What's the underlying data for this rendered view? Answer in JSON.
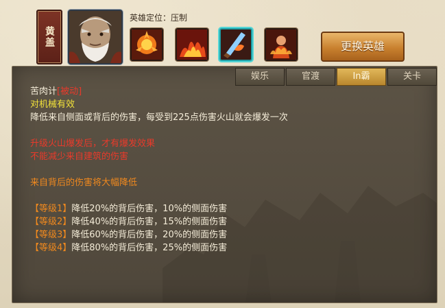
{
  "hero": {
    "name": "黄盖",
    "role_label": "英雄定位：压制",
    "change_button": "更换英雄"
  },
  "skills": [
    {
      "name": "fire-burst-icon"
    },
    {
      "name": "fire-wave-icon"
    },
    {
      "name": "flame-sword-icon"
    },
    {
      "name": "fire-monk-icon"
    }
  ],
  "tabs": [
    "娱乐",
    "官渡",
    "In霸",
    "关卡"
  ],
  "active_tab": "In霸",
  "skill_detail": {
    "title": "苦肉计",
    "tag": "[被动]",
    "effect_target": "对机械有效",
    "description": "降低来自侧面或背后的伤害，每受到225点伤害火山就会爆发一次",
    "note1": "升级火山爆发后，才有爆发效果",
    "note2": "不能减少来自建筑的伤害",
    "note3": "来自背后的伤害将大幅降低",
    "levels": [
      {
        "label": "【等级1】",
        "text": "降低20%的背后伤害，10%的侧面伤害"
      },
      {
        "label": "【等级2】",
        "text": "降低40%的背后伤害，15%的侧面伤害"
      },
      {
        "label": "【等级3】",
        "text": "降低60%的背后伤害，20%的侧面伤害"
      },
      {
        "label": "【等级4】",
        "text": "降低80%的背后伤害，25%的侧面伤害"
      }
    ]
  },
  "colors": {
    "highlight_red": "#e83a2b",
    "highlight_yellow": "#f2e23a",
    "highlight_orange": "#f0891e",
    "panel": "#544b3f",
    "active_tab": "#d4a84a"
  }
}
